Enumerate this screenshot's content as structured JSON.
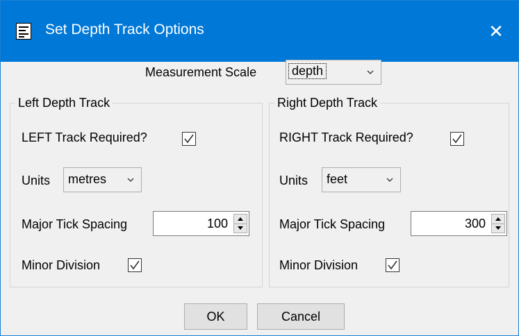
{
  "window": {
    "title": "Set Depth Track Options",
    "title_icon": "document-icon",
    "close_label": "✕",
    "titlebar_color": "#0078d7"
  },
  "measurement": {
    "label": "Measurement Scale",
    "value": "depth"
  },
  "left": {
    "group_title": "Left Depth Track",
    "required_label": "LEFT Track Required?",
    "required_checked": true,
    "units_label": "Units",
    "units_value": "metres",
    "tick_label": "Major Tick Spacing",
    "tick_value": "100",
    "minor_label": "Minor Division",
    "minor_checked": true
  },
  "right": {
    "group_title": "Right Depth Track",
    "required_label": "RIGHT Track Required?",
    "required_checked": true,
    "units_label": "Units",
    "units_value": "feet",
    "tick_label": "Major Tick Spacing",
    "tick_value": "300",
    "minor_label": "Minor Division",
    "minor_checked": true
  },
  "buttons": {
    "ok": "OK",
    "cancel": "Cancel"
  }
}
